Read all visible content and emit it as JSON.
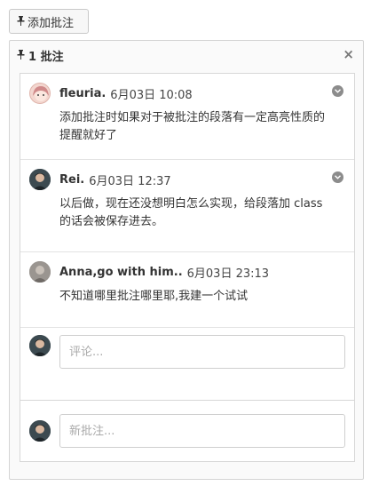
{
  "toolbar": {
    "add_label": "添加批注"
  },
  "panel": {
    "title": "1 批注"
  },
  "comments": [
    {
      "author": "fleuria.",
      "time": "6月03日 10:08",
      "text": "添加批注时如果对于被批注的段落有一定高亮性质的提醒就好了",
      "avatar": "anime-girl-avatar"
    },
    {
      "author": "Rei.",
      "time": "6月03日 12:37",
      "text": "以后做，现在还没想明白怎么实现，给段落加 class 的话会被保存进去。",
      "avatar": "person-avatar"
    },
    {
      "author": "Anna,go with him..",
      "time": "6月03日 23:13",
      "text": "不知道哪里批注哪里耶,我建一个试试",
      "avatar": "photo-avatar"
    }
  ],
  "reply": {
    "placeholder": "评论..."
  },
  "new_note": {
    "placeholder": "新批注..."
  }
}
